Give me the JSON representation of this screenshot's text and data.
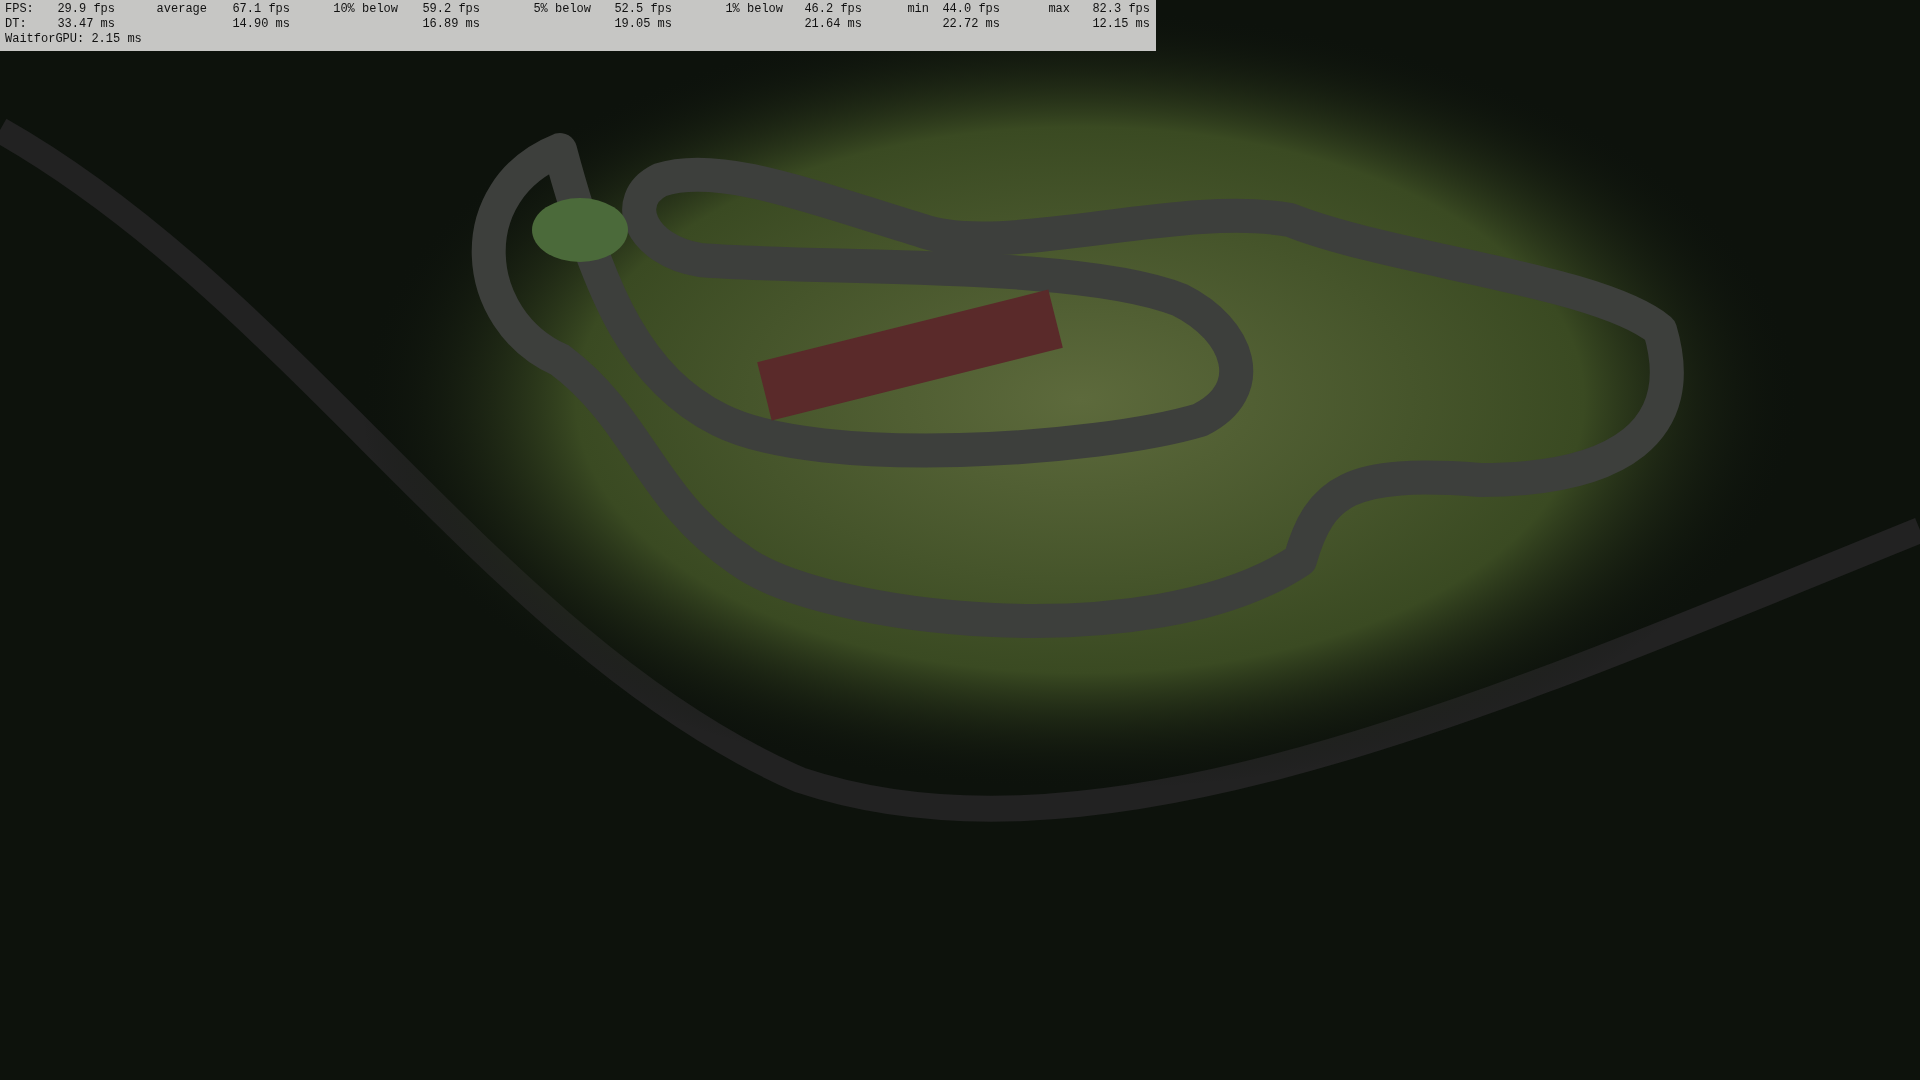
{
  "overlay": {
    "row_labels": [
      "FPS:",
      "DT:"
    ],
    "current": {
      "fps": "29.9 fps",
      "ms": "33.47 ms"
    },
    "stats": [
      {
        "label": "average",
        "fps": "67.1 fps",
        "ms": "14.90 ms"
      },
      {
        "label": "10% below",
        "fps": "59.2 fps",
        "ms": "16.89 ms"
      },
      {
        "label": "5% below",
        "fps": "52.5 fps",
        "ms": "19.05 ms"
      },
      {
        "label": "1% below",
        "fps": "46.2 fps",
        "ms": "21.64 ms"
      },
      {
        "label": "min",
        "fps": "44.0 fps",
        "ms": "22.72 ms"
      },
      {
        "label": "max",
        "fps": "82.3 fps",
        "ms": "12.15 ms"
      }
    ],
    "wait_for_gpu": "WaitforGPU: 2.15 ms"
  }
}
